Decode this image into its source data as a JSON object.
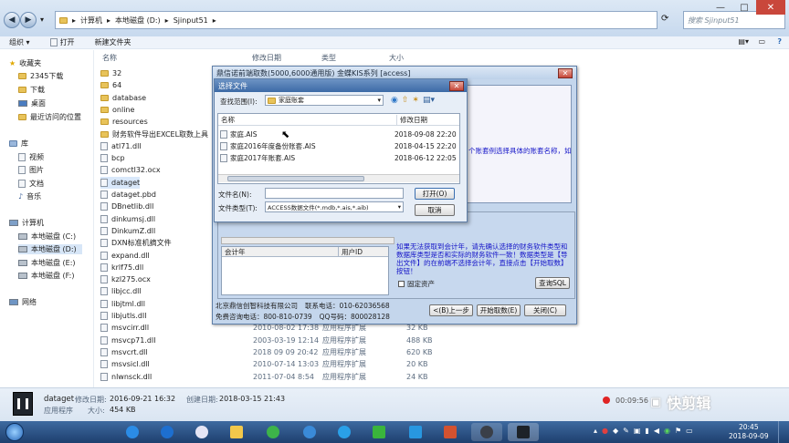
{
  "explorer": {
    "breadcrumb": [
      "计算机",
      "本地磁盘 (D:)",
      "Sjinput51"
    ],
    "search_placeholder": "搜索 Sjinput51",
    "toolbar": {
      "organize": "组织 ▾",
      "open": "打开",
      "new_folder": "新建文件夹"
    },
    "columns": {
      "name": "名称",
      "date": "修改日期",
      "type": "类型",
      "size": "大小"
    },
    "nav": {
      "favorites": "收藏夹",
      "fav_items": [
        "2345下载",
        "下载",
        "桌面",
        "最近访问的位置"
      ],
      "libraries": "库",
      "lib_items": [
        "视频",
        "图片",
        "文档",
        "音乐"
      ],
      "computer": "计算机",
      "drives": [
        "本地磁盘 (C:)",
        "本地磁盘 (D:)",
        "本地磁盘 (E:)",
        "本地磁盘 (F:)"
      ],
      "network": "网络"
    },
    "files": [
      {
        "name": "32",
        "kind": "folder",
        "date": "",
        "type": "",
        "size": ""
      },
      {
        "name": "64",
        "kind": "folder",
        "date": "",
        "type": "",
        "size": ""
      },
      {
        "name": "database",
        "kind": "folder",
        "date": "",
        "type": "",
        "size": ""
      },
      {
        "name": "online",
        "kind": "folder",
        "date": "",
        "type": "",
        "size": ""
      },
      {
        "name": "resources",
        "kind": "folder",
        "date": "",
        "type": "",
        "size": ""
      },
      {
        "name": "财务软件导出EXCEL取数上具",
        "kind": "folder",
        "date": "",
        "type": "",
        "size": ""
      },
      {
        "name": "atl71.dll",
        "kind": "file",
        "date": "",
        "type": "",
        "size": ""
      },
      {
        "name": "bcp",
        "kind": "file",
        "date": "",
        "type": "",
        "size": ""
      },
      {
        "name": "comctl32.ocx",
        "kind": "file",
        "date": "",
        "type": "",
        "size": ""
      },
      {
        "name": "dataget",
        "kind": "file",
        "date": "",
        "type": "",
        "size": ""
      },
      {
        "name": "dataget.pbd",
        "kind": "file",
        "date": "",
        "type": "",
        "size": ""
      },
      {
        "name": "DBnetlib.dll",
        "kind": "file",
        "date": "",
        "type": "",
        "size": ""
      },
      {
        "name": "dinkumsj.dll",
        "kind": "file",
        "date": "",
        "type": "",
        "size": ""
      },
      {
        "name": "DinkumZ.dll",
        "kind": "file",
        "date": "",
        "type": "",
        "size": ""
      },
      {
        "name": "DXN标准机摘文件",
        "kind": "file",
        "date": "",
        "type": "",
        "size": ""
      },
      {
        "name": "expand.dll",
        "kind": "file",
        "date": "",
        "type": "",
        "size": ""
      },
      {
        "name": "krlf75.dll",
        "kind": "file",
        "date": "",
        "type": "",
        "size": ""
      },
      {
        "name": "kzl275.ocx",
        "kind": "file",
        "date": "",
        "type": "",
        "size": ""
      },
      {
        "name": "libjcc.dll",
        "kind": "file",
        "date": "",
        "type": "",
        "size": ""
      },
      {
        "name": "libjtml.dll",
        "kind": "file",
        "date": "",
        "type": "",
        "size": ""
      },
      {
        "name": "libjutls.dll",
        "kind": "file",
        "date": "",
        "type": "",
        "size": ""
      },
      {
        "name": "msvcirr.dll",
        "kind": "file",
        "date": "2010-08-02 17:38",
        "type": "应用程序扩展",
        "size": "32 KB"
      },
      {
        "name": "msvcp71.dll",
        "kind": "file",
        "date": "2003-03-19 12:14",
        "type": "应用程序扩展",
        "size": "488 KB"
      },
      {
        "name": "msvcrt.dll",
        "kind": "file",
        "date": "2018 09 09 20:42",
        "type": "应用程序扩展",
        "size": "620 KB"
      },
      {
        "name": "msvsicl.dll",
        "kind": "file",
        "date": "2010-07-14 13:03",
        "type": "应用程序扩展",
        "size": "20 KB"
      },
      {
        "name": "nlwnsck.dll",
        "kind": "file",
        "date": "2011-07-04 8:54",
        "type": "应用程序扩展",
        "size": "24 KB"
      }
    ],
    "status": {
      "filename": "dataget",
      "modified_label": "修改日期:",
      "modified": "2016-09-21 16:32",
      "created_label": "创建日期:",
      "created": "2018-03-15 21:43",
      "kind": "应用程序",
      "size_label": "大小:",
      "size": "454 KB"
    }
  },
  "main_dialog": {
    "title": "鼎信诺前端取数(5000,6000通用版)   金蝶KIS系列  [access]",
    "right_text": "个账套例选择具体的账套名称，如",
    "grid_headers": [
      "会计年",
      "用户ID"
    ],
    "note": "如果无法获取到会计年，请先确认选择的财务软件类型和数据库类型是否和实际的财务软件一致！数据类型是【导出文件】的在前端不选择会计年，直接点击【开始取数】按钮！",
    "fixed_asset_label": "固定资产",
    "query_sql": "查询SQL",
    "company": "北京鼎信创智科技有限公司",
    "phone_label": "联系电话：010-62036568",
    "hotline": "免费咨询电话：800-810-0739",
    "qq": "QQ号码：800028128",
    "buttons": {
      "prev": "<(B)上一步",
      "start": "开始取数(E)",
      "close": "关闭(C)"
    }
  },
  "open_dialog": {
    "title": "选择文件",
    "lookin_label": "查找范围(I):",
    "lookin_value": "家庭账套",
    "col_name": "名称",
    "col_date": "修改日期",
    "files": [
      {
        "name": "家庭.AIS",
        "date": "2018-09-08 22:20"
      },
      {
        "name": "家庭2016年度备份账套.AIS",
        "date": "2018-04-15 22:20"
      },
      {
        "name": "家庭2017年账套.AIS",
        "date": "2018-06-12 22:05"
      }
    ],
    "filename_label": "文件名(N):",
    "filetype_label": "文件类型(T):",
    "filetype_value": "ACCESS数据文件(*.mdb,*.ais,*.aib)",
    "open_button": "打开(O)",
    "cancel_button": "取消"
  },
  "recorder": {
    "time": "00:09:56",
    "brand": "快剪辑"
  },
  "taskbar": {
    "time": "20:45",
    "date": "2018-09-09"
  }
}
